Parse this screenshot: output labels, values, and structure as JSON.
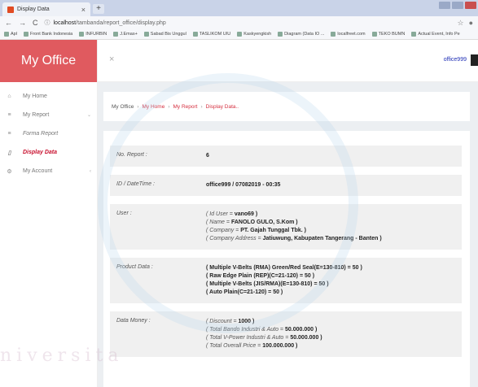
{
  "browser": {
    "tab_title": "Display Data",
    "url_host": "localhost",
    "url_path": "/tambanda/report_office/display.php",
    "bookmarks": [
      "Apl",
      "Front Bank Indonesia",
      "INFURBIN",
      "J.Emas+",
      "Sabad Bis Unggul",
      "TASLIKOM UIU",
      "Kaskyengkish",
      "Diagram (Data IO ...",
      "localfreet.com",
      "TEKO BUMN",
      "Actual Event, Info Pe"
    ]
  },
  "sidebar": {
    "brand": "My Office",
    "items": [
      {
        "label": "My Home",
        "icon": "home-icon",
        "glyph": "⌂",
        "chev": ""
      },
      {
        "label": "My Report",
        "icon": "list-icon",
        "glyph": "≡",
        "chev": "⌄"
      },
      {
        "label": "Forma Report",
        "icon": "list-icon",
        "glyph": "≡",
        "chev": ""
      },
      {
        "label": "Display Data",
        "icon": "file-icon",
        "glyph": "▯",
        "chev": ""
      },
      {
        "label": "My Account",
        "icon": "gear-icon",
        "glyph": "⚙",
        "chev": "‹"
      }
    ]
  },
  "header": {
    "close": "×",
    "username": "office999"
  },
  "breadcrumb": {
    "root": "My Office",
    "home": "My Home",
    "report": "My Report",
    "current": "Display Data.."
  },
  "detail": {
    "no_report_label": "No. Report :",
    "no_report": "6",
    "id_label": "ID / DateTime :",
    "id_value": "office999 / 07082019 - 00:35",
    "user_label": "User :",
    "user_lines": [
      {
        "label": "( Id User = ",
        "value": "vano69 )"
      },
      {
        "label": "( Name = ",
        "value": "FANOLO GULO, S.Kom )"
      },
      {
        "label": "( Company = ",
        "value": "PT. Gajah Tunggal Tbk. )"
      },
      {
        "label": "( Company Address = ",
        "value": "Jatiuwung, Kabupaten Tangerang - Banten )"
      }
    ],
    "product_label": "Product Data :",
    "product_lines": [
      "( Multiple V-Belts (RMA) Green/Red Seal(E=130-810) = 50 )",
      "( Raw Edge Plain (REP)(C=21-120) = 50 )",
      "( Multiple V-Belts (JIS/RMA)(E=130-810) = 50 )",
      "( Auto Plain(C=21-120) = 50 )"
    ],
    "money_label": "Data Money :",
    "money_lines": [
      {
        "label": "( Discount = ",
        "value": "1000 )"
      },
      {
        "label": "( Total Bando Industri & Auto = ",
        "value": "50.000.000 )"
      },
      {
        "label": "( Total V-Power Industri & Auto = ",
        "value": "50.000.000 )"
      },
      {
        "label": "( Total Overall Price = ",
        "value": "100.000.000 )"
      }
    ]
  },
  "watermark": "niversita",
  "colors": {
    "brand": "#e05a5f",
    "active": "#c8102e",
    "user": "#1f2fb5"
  }
}
